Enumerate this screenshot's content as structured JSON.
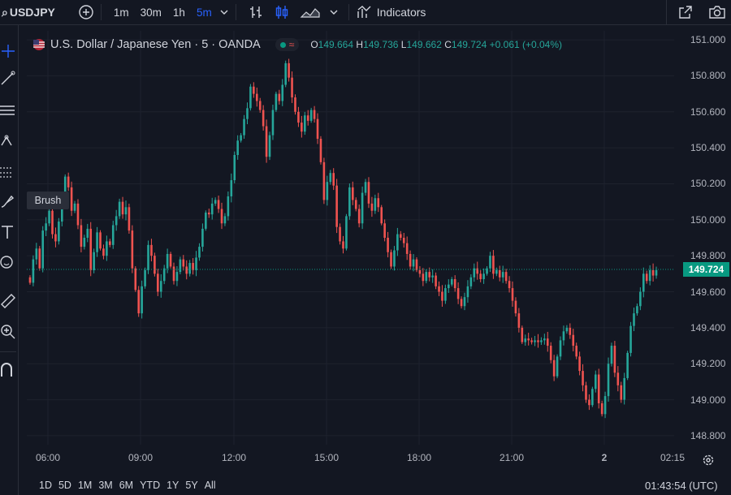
{
  "toolbar": {
    "symbol": "USDJPY",
    "timeframes": [
      "1m",
      "30m",
      "1h",
      "5m"
    ],
    "active_timeframe": "5m",
    "indicators_label": "Indicators"
  },
  "legend": {
    "title": "U.S. Dollar / Japanese Yen · 5 · OANDA",
    "o_label": "O",
    "o": "149.664",
    "h_label": "H",
    "h": "149.736",
    "l_label": "L",
    "l": "149.662",
    "c_label": "C",
    "c": "149.724",
    "change": "+0.061 (+0.04%)"
  },
  "tooltip": "Brush",
  "price_axis": {
    "labels": [
      "151.000",
      "150.800",
      "150.600",
      "150.400",
      "150.200",
      "150.000",
      "149.800",
      "149.600",
      "149.400",
      "149.200",
      "149.000",
      "148.800"
    ],
    "current_price": "149.724"
  },
  "time_axis": {
    "labels": [
      "06:00",
      "09:00",
      "12:00",
      "15:00",
      "18:00",
      "21:00",
      "2",
      "02:15"
    ]
  },
  "bottom": {
    "ranges": [
      "1D",
      "5D",
      "1M",
      "3M",
      "6M",
      "YTD",
      "1Y",
      "5Y",
      "All"
    ],
    "clock": "01:43:54 (UTC)"
  },
  "colors": {
    "up": "#26a69a",
    "down": "#ef5350",
    "bg": "#131722",
    "accent": "#2962ff"
  },
  "chart_data": {
    "type": "candlestick",
    "ylim": [
      148.75,
      151.05
    ],
    "closes": [
      149.65,
      149.78,
      149.84,
      149.73,
      149.94,
      149.98,
      150.05,
      149.92,
      149.88,
      149.99,
      150.12,
      150.24,
      150.18,
      150.05,
      150.09,
      149.97,
      149.85,
      149.9,
      149.95,
      149.72,
      149.82,
      149.93,
      149.84,
      149.8,
      149.88,
      149.86,
      149.97,
      150.02,
      150.1,
      150.03,
      150.07,
      149.94,
      149.73,
      149.61,
      149.48,
      149.63,
      149.72,
      149.86,
      149.8,
      149.7,
      149.6,
      149.66,
      149.73,
      149.81,
      149.74,
      149.66,
      149.71,
      149.78,
      149.74,
      149.7,
      149.76,
      149.72,
      149.79,
      149.85,
      149.95,
      150.04,
      150.03,
      150.09,
      150.11,
      150.06,
      149.98,
      150.02,
      150.13,
      150.22,
      150.36,
      150.44,
      150.47,
      150.56,
      150.62,
      150.74,
      150.7,
      150.66,
      150.61,
      150.52,
      150.35,
      150.47,
      150.61,
      150.7,
      150.66,
      150.75,
      150.87,
      150.79,
      150.68,
      150.6,
      150.54,
      150.49,
      150.58,
      150.55,
      150.61,
      150.56,
      150.45,
      150.32,
      150.11,
      150.21,
      150.26,
      150.19,
      149.96,
      149.88,
      149.84,
      150.02,
      150.18,
      150.11,
      150.06,
      149.98,
      150.15,
      150.21,
      150.09,
      150.05,
      150.12,
      150.07,
      149.98,
      149.9,
      149.82,
      149.74,
      149.83,
      149.92,
      149.9,
      149.87,
      149.81,
      149.74,
      149.78,
      149.72,
      149.7,
      149.66,
      149.71,
      149.68,
      149.69,
      149.63,
      149.6,
      149.55,
      149.62,
      149.64,
      149.67,
      149.62,
      149.56,
      149.52,
      149.57,
      149.63,
      149.68,
      149.73,
      149.7,
      149.67,
      149.7,
      149.73,
      149.8,
      149.7,
      149.72,
      149.68,
      149.71,
      149.66,
      149.62,
      149.55,
      149.48,
      149.4,
      149.32,
      149.34,
      149.33,
      149.32,
      149.33,
      149.32,
      149.33,
      149.34,
      149.3,
      149.22,
      149.13,
      149.24,
      149.33,
      149.38,
      149.4,
      149.36,
      149.3,
      149.24,
      149.16,
      149.08,
      149.0,
      148.97,
      149.06,
      149.14,
      148.98,
      148.92,
      149.02,
      149.2,
      149.3,
      149.15,
      149.08,
      149.0,
      149.12,
      149.26,
      149.41,
      149.48,
      149.52,
      149.6,
      149.7,
      149.66,
      149.72,
      149.69,
      149.72
    ]
  }
}
